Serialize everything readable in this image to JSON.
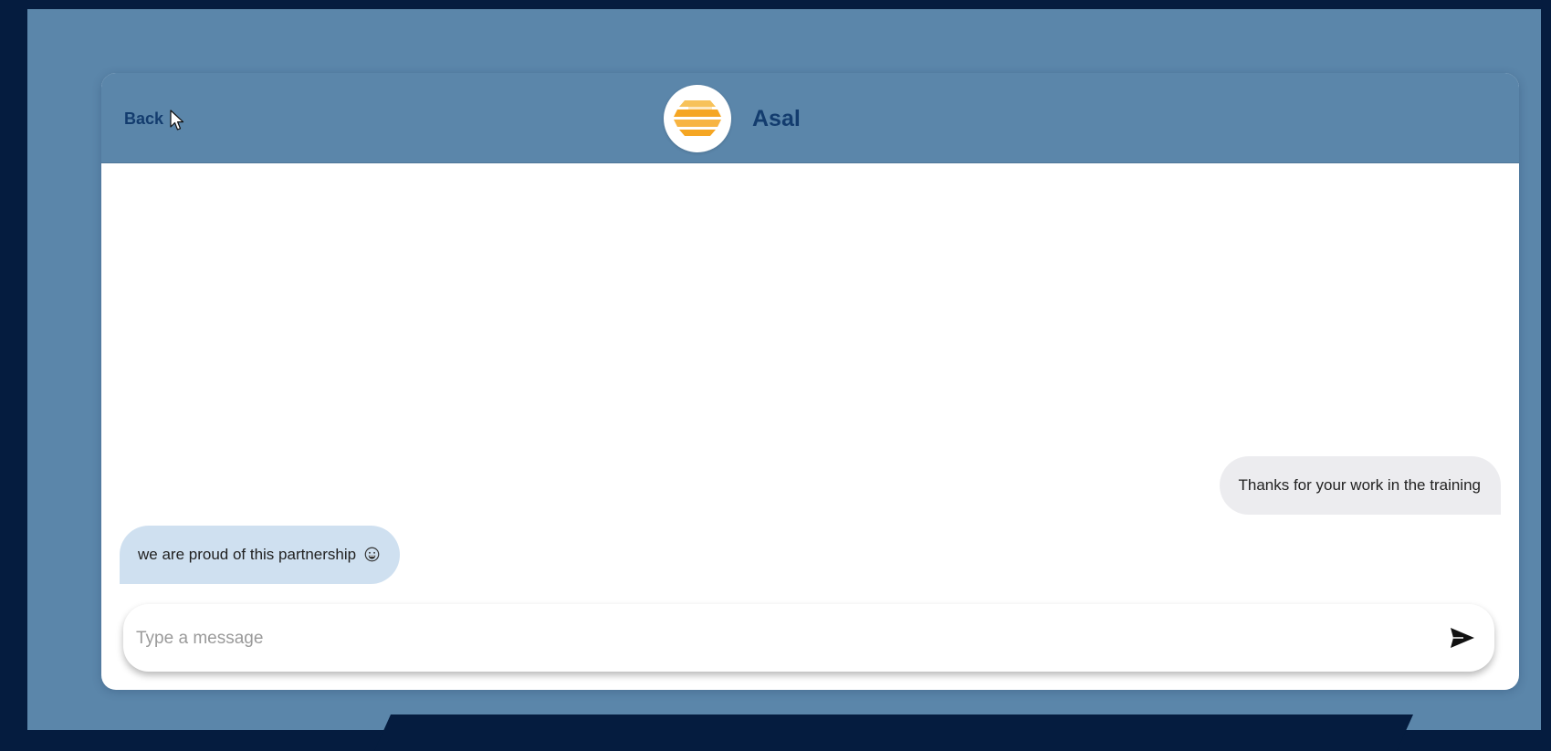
{
  "header": {
    "back_label": "Back",
    "contact_name": "Asal",
    "avatar_icon": "honeycomb-logo-icon"
  },
  "messages": [
    {
      "direction": "outgoing",
      "text": "Thanks for your work in the training"
    },
    {
      "direction": "incoming",
      "text": "we are proud of this partnership",
      "emoji": "grinning-face-icon"
    }
  ],
  "composer": {
    "placeholder": "Type a message",
    "value": "",
    "send_icon": "send-icon"
  },
  "colors": {
    "page_background": "#051c3f",
    "frame_background": "#5b86aa",
    "header_text": "#133c6e",
    "outgoing_bubble": "#ececef",
    "incoming_bubble": "#cfe0f0",
    "logo_orange": "#f5a623"
  }
}
